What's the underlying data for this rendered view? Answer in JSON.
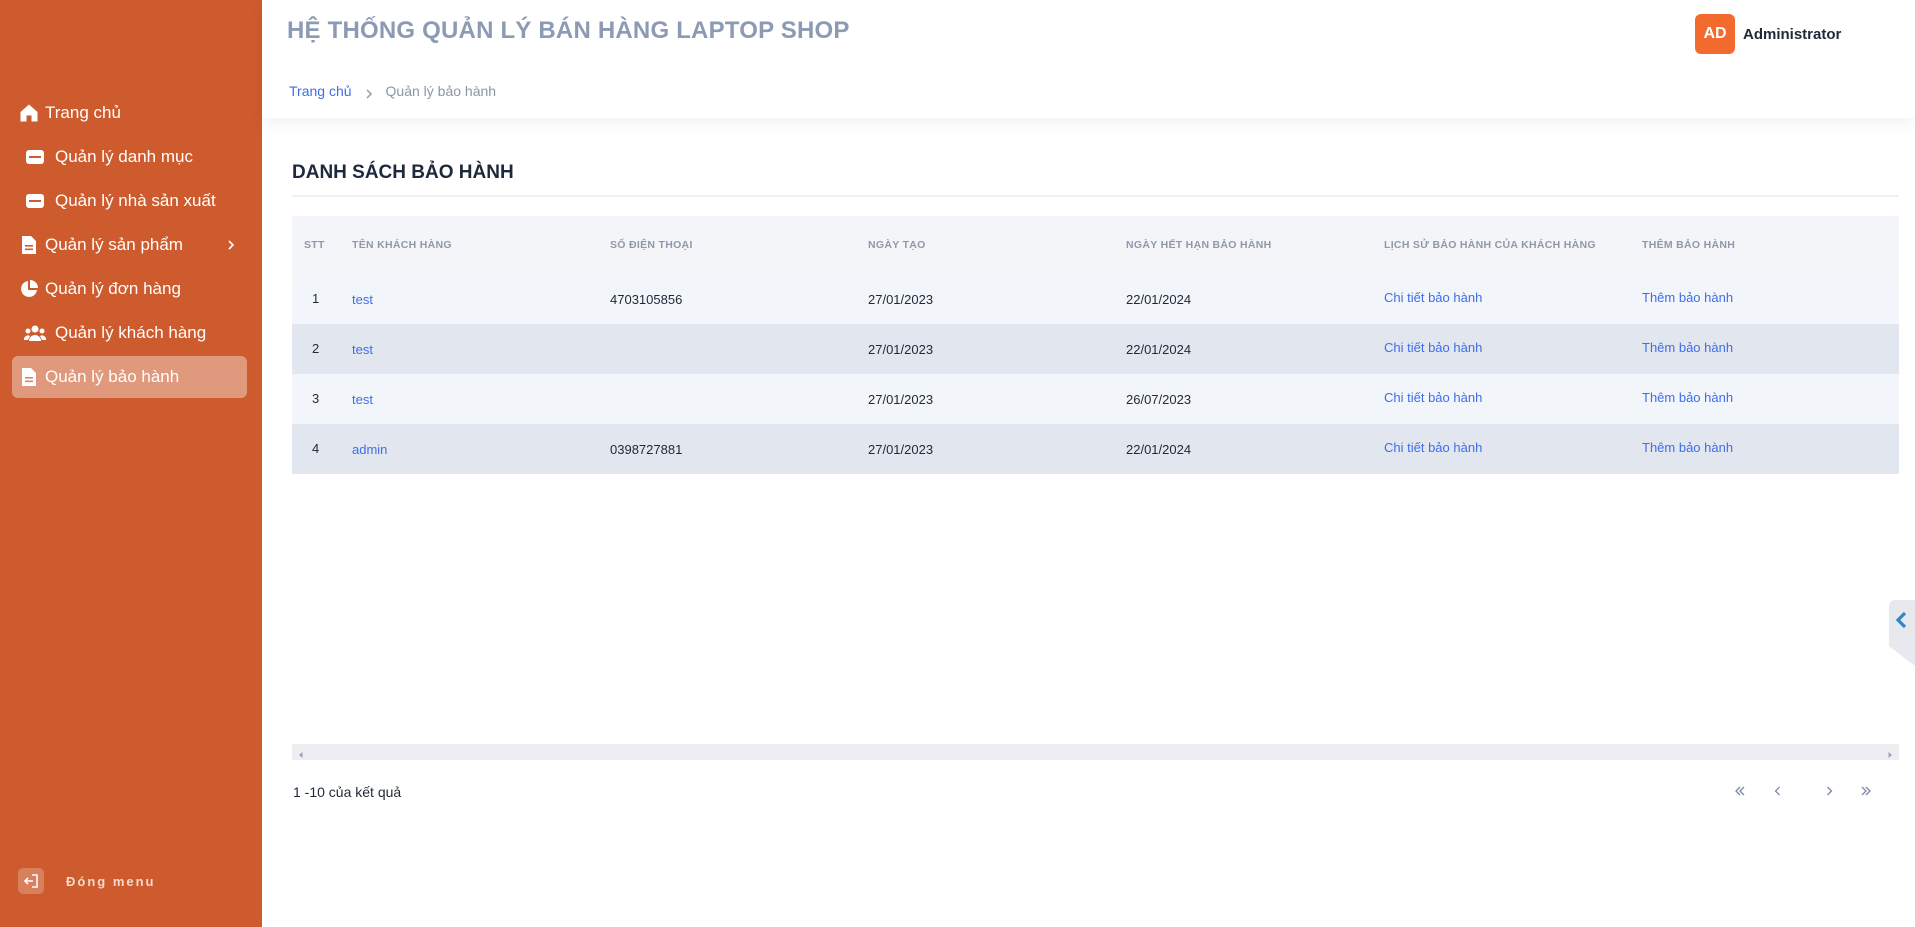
{
  "app": {
    "title": "HỆ THỐNG QUẢN LÝ BÁN HÀNG LAPTOP SHOP"
  },
  "user": {
    "initials": "AD",
    "name": "Administrator"
  },
  "breadcrumb": {
    "home": "Trang chủ",
    "current": "Quản lý bảo hành"
  },
  "sidebar": {
    "items": [
      {
        "label": "Trang chủ",
        "icon": "home-icon"
      },
      {
        "label": "Quản lý danh mục",
        "icon": "folder-icon"
      },
      {
        "label": "Quản lý nhà sản xuất",
        "icon": "folder-icon"
      },
      {
        "label": "Quản lý sản phẩm",
        "icon": "document-icon",
        "has_submenu": true
      },
      {
        "label": "Quản lý đơn hàng",
        "icon": "pie-chart-icon"
      },
      {
        "label": "Quản lý khách hàng",
        "icon": "users-icon"
      },
      {
        "label": "Quản lý bảo hành",
        "icon": "document-icon",
        "active": true
      }
    ],
    "close_label": "Đóng menu"
  },
  "section": {
    "title": "DANH SÁCH BẢO HÀNH"
  },
  "table": {
    "headers": [
      "STT",
      "TÊN KHÁCH HÀNG",
      "SỐ ĐIỆN THOẠI",
      "NGÀY TẠO",
      "NGÀY HẾT HẠN BẢO HÀNH",
      "LỊCH SỬ BẢO HÀNH CỦA KHÁCH HÀNG",
      "THÊM BẢO HÀNH"
    ],
    "rows": [
      {
        "stt": "1",
        "name": "test",
        "phone": "4703105856",
        "created": "27/01/2023",
        "expires": "22/01/2024",
        "history": "Chi tiết bảo hành",
        "add": "Thêm bảo hành"
      },
      {
        "stt": "2",
        "name": "test",
        "phone": "",
        "created": "27/01/2023",
        "expires": "22/01/2024",
        "history": "Chi tiết bảo hành",
        "add": "Thêm bảo hành"
      },
      {
        "stt": "3",
        "name": "test",
        "phone": "",
        "created": "27/01/2023",
        "expires": "26/07/2023",
        "history": "Chi tiết bảo hành",
        "add": "Thêm bảo hành"
      },
      {
        "stt": "4",
        "name": "admin",
        "phone": "0398727881",
        "created": "27/01/2023",
        "expires": "22/01/2024",
        "history": "Chi tiết bảo hành",
        "add": "Thêm bảo hành"
      }
    ]
  },
  "pagination": {
    "summary": "1 -10 của kết quả"
  },
  "colors": {
    "sidebar": "#cd5b2d",
    "accent": "#f26a2e",
    "link": "#3f6ee8"
  }
}
